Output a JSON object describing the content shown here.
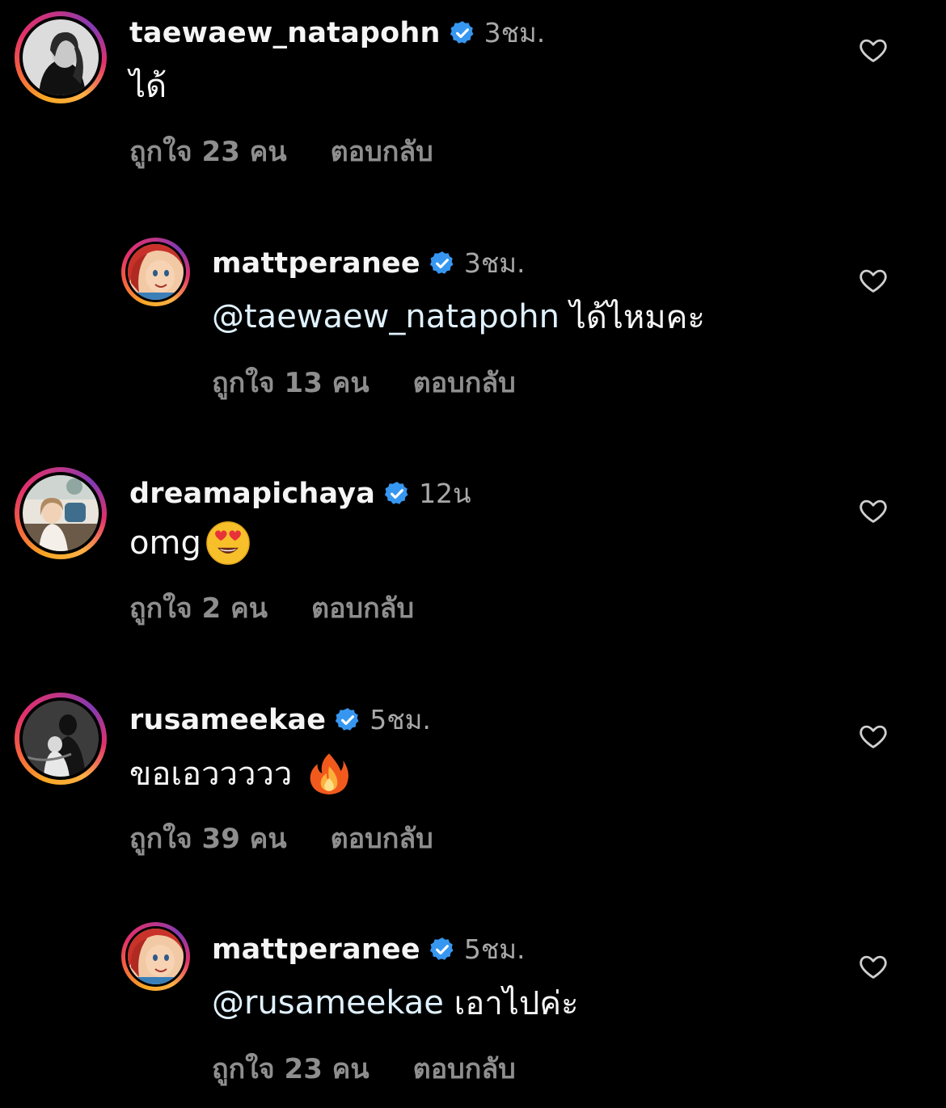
{
  "comments": [
    {
      "username": "taewaew_natapohn",
      "time": "3ชม.",
      "text": "ได้",
      "mention": "",
      "emoji": "",
      "likes": "ถูกใจ 23 คน",
      "reply": "ตอบกลับ",
      "verified": true,
      "is_reply": false
    },
    {
      "username": "mattperanee",
      "time": "3ชม.",
      "text": " ได้ไหมคะ",
      "mention": "@taewaew_natapohn",
      "emoji": "",
      "likes": "ถูกใจ 13 คน",
      "reply": "ตอบกลับ",
      "verified": true,
      "is_reply": true
    },
    {
      "username": "dreamapichaya",
      "time": "12น",
      "text": "omg",
      "mention": "",
      "emoji": "heart-eyes-emoji",
      "likes": "ถูกใจ 2 คน",
      "reply": "ตอบกลับ",
      "verified": true,
      "is_reply": false
    },
    {
      "username": "rusameekae",
      "time": "5ชม.",
      "text": "ขอเอววววว ",
      "mention": "",
      "emoji": "fire-emoji",
      "likes": "ถูกใจ 39 คน",
      "reply": "ตอบกลับ",
      "verified": true,
      "is_reply": false
    },
    {
      "username": "mattperanee",
      "time": "5ชม.",
      "text": " เอาไปค่ะ",
      "mention": "@rusameekae",
      "emoji": "",
      "likes": "ถูกใจ 23 คน",
      "reply": "ตอบกลับ",
      "verified": true,
      "is_reply": true
    }
  ],
  "colors": {
    "background": "#000000",
    "username": "#f5f5f5",
    "time": "#a8a8a8",
    "meta": "#8e8e8e",
    "mention": "#e0f1ff",
    "verified": "#3797f0"
  },
  "icons": {
    "like": "heart-outline-icon",
    "verified": "verified-badge-icon"
  }
}
